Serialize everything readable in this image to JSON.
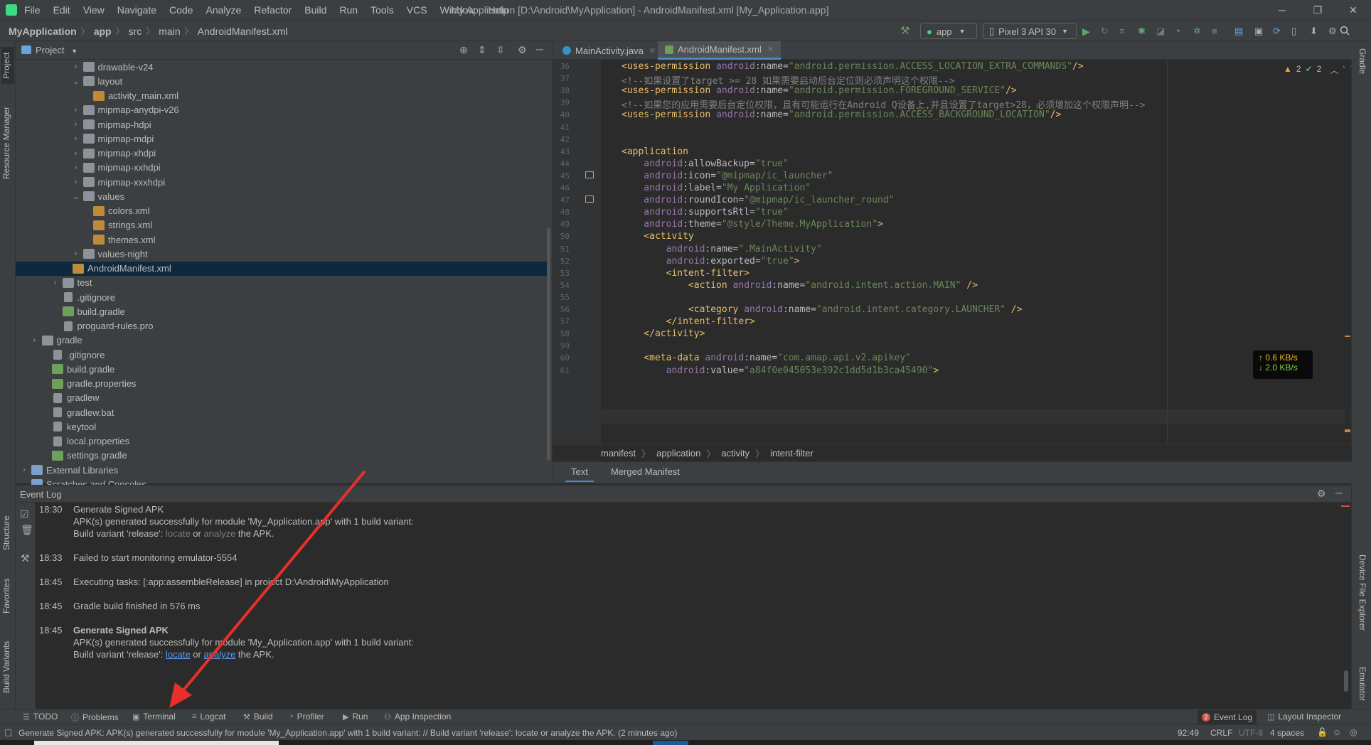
{
  "menubar": {
    "items": [
      "File",
      "Edit",
      "View",
      "Navigate",
      "Code",
      "Analyze",
      "Refactor",
      "Build",
      "Run",
      "Tools",
      "VCS",
      "Window",
      "Help"
    ],
    "title": "My Application [D:\\Android\\MyApplication] - AndroidManifest.xml [My_Application.app]"
  },
  "navbar": {
    "crumbs": [
      "MyApplication",
      "app",
      "src",
      "main",
      "AndroidManifest.xml"
    ],
    "run_config": "app",
    "device": "Pixel 3 API 30"
  },
  "left_strip": {
    "project": "Project",
    "resource_manager": "Resource Manager",
    "structure": "Structure",
    "favorites": "Favorites",
    "build_variants": "Build Variants"
  },
  "right_strip": {
    "gradle": "Gradle",
    "device_file_explorer": "Device File Explorer",
    "emulator": "Emulator"
  },
  "project": {
    "header": "Project",
    "tree": [
      {
        "label": "drawable-v24",
        "type": "folder",
        "depth": 5,
        "exp": "closed"
      },
      {
        "label": "layout",
        "type": "folder",
        "depth": 5,
        "exp": "open"
      },
      {
        "label": "activity_main.xml",
        "type": "xml",
        "depth": 6,
        "exp": "none"
      },
      {
        "label": "mipmap-anydpi-v26",
        "type": "folder",
        "depth": 5,
        "exp": "closed"
      },
      {
        "label": "mipmap-hdpi",
        "type": "folder",
        "depth": 5,
        "exp": "closed"
      },
      {
        "label": "mipmap-mdpi",
        "type": "folder",
        "depth": 5,
        "exp": "closed"
      },
      {
        "label": "mipmap-xhdpi",
        "type": "folder",
        "depth": 5,
        "exp": "closed"
      },
      {
        "label": "mipmap-xxhdpi",
        "type": "folder",
        "depth": 5,
        "exp": "closed"
      },
      {
        "label": "mipmap-xxxhdpi",
        "type": "folder",
        "depth": 5,
        "exp": "closed"
      },
      {
        "label": "values",
        "type": "folder",
        "depth": 5,
        "exp": "open"
      },
      {
        "label": "colors.xml",
        "type": "xml",
        "depth": 6,
        "exp": "none"
      },
      {
        "label": "strings.xml",
        "type": "xml",
        "depth": 6,
        "exp": "none"
      },
      {
        "label": "themes.xml",
        "type": "xml",
        "depth": 6,
        "exp": "none"
      },
      {
        "label": "values-night",
        "type": "folder",
        "depth": 5,
        "exp": "closed"
      },
      {
        "label": "AndroidManifest.xml",
        "type": "xml",
        "depth": 4,
        "exp": "none",
        "selected": true
      },
      {
        "label": "test",
        "type": "folder",
        "depth": 3,
        "exp": "closed"
      },
      {
        "label": ".gitignore",
        "type": "file",
        "depth": 3,
        "exp": "none"
      },
      {
        "label": "build.gradle",
        "type": "gradle",
        "depth": 3,
        "exp": "none"
      },
      {
        "label": "proguard-rules.pro",
        "type": "file",
        "depth": 3,
        "exp": "none"
      },
      {
        "label": "gradle",
        "type": "folder",
        "depth": 1,
        "exp": "closed"
      },
      {
        "label": ".gitignore",
        "type": "file",
        "depth": 2,
        "exp": "none"
      },
      {
        "label": "build.gradle",
        "type": "gradle",
        "depth": 2,
        "exp": "none"
      },
      {
        "label": "gradle.properties",
        "type": "gradle",
        "depth": 2,
        "exp": "none"
      },
      {
        "label": "gradlew",
        "type": "file",
        "depth": 2,
        "exp": "none"
      },
      {
        "label": "gradlew.bat",
        "type": "file",
        "depth": 2,
        "exp": "none"
      },
      {
        "label": "keytool",
        "type": "file",
        "depth": 2,
        "exp": "none"
      },
      {
        "label": "local.properties",
        "type": "file",
        "depth": 2,
        "exp": "none"
      },
      {
        "label": "settings.gradle",
        "type": "gradle",
        "depth": 2,
        "exp": "none"
      },
      {
        "label": "External Libraries",
        "type": "lib",
        "depth": 0,
        "exp": "closed"
      },
      {
        "label": "Scratches and Consoles",
        "type": "lib",
        "depth": 0,
        "exp": "none"
      }
    ]
  },
  "editor": {
    "tabs": [
      {
        "label": "MainActivity.java",
        "active": false
      },
      {
        "label": "AndroidManifest.xml",
        "active": true
      }
    ],
    "inspections": {
      "warnings": "2",
      "ok": "2"
    },
    "lines": [
      {
        "n": "36",
        "segs": [
          [
            "t-tag",
            "<uses-permission "
          ],
          [
            "t-ns",
            "android"
          ],
          [
            "t-attr",
            ":name="
          ],
          [
            "t-val",
            "\"android.permission.ACCESS_LOCATION_EXTRA_COMMANDS\""
          ],
          [
            "t-tag",
            "/>"
          ]
        ]
      },
      {
        "n": "37",
        "segs": [
          [
            "t-cmt",
            "<!--如果设置了target >= 28 如果需要启动后台定位则必须声明这个权限-->"
          ]
        ]
      },
      {
        "n": "38",
        "segs": [
          [
            "t-tag",
            "<uses-permission "
          ],
          [
            "t-ns",
            "android"
          ],
          [
            "t-attr",
            ":name="
          ],
          [
            "t-val",
            "\"android.permission.FOREGROUND_SERVICE\""
          ],
          [
            "t-tag",
            "/>"
          ]
        ]
      },
      {
        "n": "39",
        "segs": [
          [
            "t-cmt",
            "<!--如果您的应用需要后台定位权限，且有可能运行在Android Q设备上,并且设置了target>28，必须增加这个权限声明-->"
          ]
        ]
      },
      {
        "n": "40",
        "segs": [
          [
            "t-tag",
            "<uses-permission "
          ],
          [
            "t-ns",
            "android"
          ],
          [
            "t-attr",
            ":name="
          ],
          [
            "t-val",
            "\"android.permission.ACCESS_BACKGROUND_LOCATION\""
          ],
          [
            "t-tag",
            "/>"
          ]
        ]
      },
      {
        "n": "41",
        "segs": []
      },
      {
        "n": "42",
        "segs": []
      },
      {
        "n": "43",
        "segs": [
          [
            "t-tag",
            "<application"
          ]
        ]
      },
      {
        "n": "44",
        "segs": [
          [
            "t-ns",
            "    android"
          ],
          [
            "t-attr",
            ":allowBackup="
          ],
          [
            "t-val",
            "\"true\""
          ]
        ]
      },
      {
        "n": "45",
        "segs": [
          [
            "t-ns",
            "    android"
          ],
          [
            "t-attr",
            ":icon="
          ],
          [
            "t-val",
            "\"@mipmap/ic_launcher\""
          ]
        ]
      },
      {
        "n": "46",
        "segs": [
          [
            "t-ns",
            "    android"
          ],
          [
            "t-attr",
            ":label="
          ],
          [
            "t-val",
            "\"My Application\""
          ]
        ]
      },
      {
        "n": "47",
        "segs": [
          [
            "t-ns",
            "    android"
          ],
          [
            "t-attr",
            ":roundIcon="
          ],
          [
            "t-val",
            "\"@mipmap/ic_launcher_round\""
          ]
        ]
      },
      {
        "n": "48",
        "segs": [
          [
            "t-ns",
            "    android"
          ],
          [
            "t-attr",
            ":supportsRtl="
          ],
          [
            "t-val",
            "\"true\""
          ]
        ]
      },
      {
        "n": "49",
        "segs": [
          [
            "t-ns",
            "    android"
          ],
          [
            "t-attr",
            ":theme="
          ],
          [
            "t-val",
            "\"@style/Theme.MyApplication\""
          ],
          [
            "t-tag",
            ">"
          ]
        ]
      },
      {
        "n": "50",
        "segs": [
          [
            "t-tag",
            "    <activity"
          ]
        ]
      },
      {
        "n": "51",
        "segs": [
          [
            "t-ns",
            "        android"
          ],
          [
            "t-attr",
            ":name="
          ],
          [
            "t-val",
            "\".MainActivity\""
          ]
        ]
      },
      {
        "n": "52",
        "segs": [
          [
            "t-ns",
            "        android"
          ],
          [
            "t-attr",
            ":exported="
          ],
          [
            "t-val",
            "\"true\""
          ],
          [
            "t-tag",
            ">"
          ]
        ]
      },
      {
        "n": "53",
        "segs": [
          [
            "t-tag",
            "        <intent-filter>"
          ]
        ]
      },
      {
        "n": "54",
        "segs": [
          [
            "t-tag",
            "            <action "
          ],
          [
            "t-ns",
            "android"
          ],
          [
            "t-attr",
            ":name="
          ],
          [
            "t-val",
            "\"android.intent.action.MAIN\""
          ],
          [
            "t-tag",
            " />"
          ]
        ]
      },
      {
        "n": "55",
        "segs": []
      },
      {
        "n": "56",
        "segs": [
          [
            "t-tag",
            "            <category "
          ],
          [
            "t-ns",
            "android"
          ],
          [
            "t-attr",
            ":name="
          ],
          [
            "t-val",
            "\"android.intent.category.LAUNCHER\""
          ],
          [
            "t-tag",
            " />"
          ]
        ]
      },
      {
        "n": "57",
        "segs": [
          [
            "t-tag",
            "        </intent-filter>"
          ]
        ]
      },
      {
        "n": "58",
        "segs": [
          [
            "t-tag",
            "    </activity>"
          ]
        ]
      },
      {
        "n": "59",
        "segs": []
      },
      {
        "n": "60",
        "segs": [
          [
            "t-tag",
            "    <meta-data "
          ],
          [
            "t-ns",
            "android"
          ],
          [
            "t-attr",
            ":name="
          ],
          [
            "t-val",
            "\"com.amap.api.v2.apikey\""
          ]
        ]
      },
      {
        "n": "61",
        "segs": [
          [
            "t-ns",
            "        android"
          ],
          [
            "t-attr",
            ":value="
          ],
          [
            "t-val",
            "\"a84f0e045053e392c1dd5d1b3ca45490\""
          ],
          [
            "t-tag",
            ">"
          ]
        ]
      }
    ],
    "breadcrumb": [
      "manifest",
      "application",
      "activity",
      "intent-filter"
    ],
    "bottom_tabs": [
      "Text",
      "Merged Manifest"
    ]
  },
  "net_speed": {
    "up": "↑ 0.6 KB/s",
    "down": "↓ 2.0 KB/s"
  },
  "event_log": {
    "title": "Event Log",
    "entries": [
      {
        "time": "18:30",
        "msg": "Generate Signed APK",
        "bold": false
      },
      {
        "time": "",
        "msg": "APK(s) generated successfully for module 'My_Application.app' with 1 build variant:",
        "bold": false
      },
      {
        "time": "",
        "msg": "variant1",
        "bold": false
      },
      {
        "time": "18:33",
        "msg": "Failed to start monitoring emulator-5554",
        "bold": false
      },
      {
        "time": "18:45",
        "msg": "Executing tasks: [:app:assembleRelease] in project D:\\Android\\MyApplication",
        "bold": false
      },
      {
        "time": "18:45",
        "msg": "Gradle build finished in 576 ms",
        "bold": false
      },
      {
        "time": "18:45",
        "msg": "Generate Signed APK",
        "bold": true
      },
      {
        "time": "",
        "msg": "APK(s) generated successfully for module 'My_Application.app' with 1 build variant:",
        "bold": false
      },
      {
        "time": "",
        "msg": "variant2",
        "bold": false
      }
    ],
    "variant": {
      "prefix": "Build variant 'release': ",
      "locate": "locate",
      "or": " or ",
      "analyze": "analyze",
      "suffix": " the APK."
    }
  },
  "bottom_toolbar": {
    "items": [
      "TODO",
      "Problems",
      "Terminal",
      "Logcat",
      "Build",
      "Profiler",
      "Run",
      "App Inspection"
    ],
    "event_log": "Event Log",
    "event_log_badge": "2",
    "layout_inspector": "Layout Inspector"
  },
  "statusbar": {
    "message": "Generate Signed APK: APK(s) generated successfully for module 'My_Application.app' with 1 build variant: // Build variant 'release': locate or analyze the APK. (2 minutes ago)",
    "position": "92:49",
    "line_sep": "CRLF",
    "encoding": "UTF-8",
    "indent": "4 spaces"
  },
  "colors": {
    "annotation_arrow": "#e8302a",
    "selection": "#0d293e",
    "accent": "#4a88c7"
  }
}
